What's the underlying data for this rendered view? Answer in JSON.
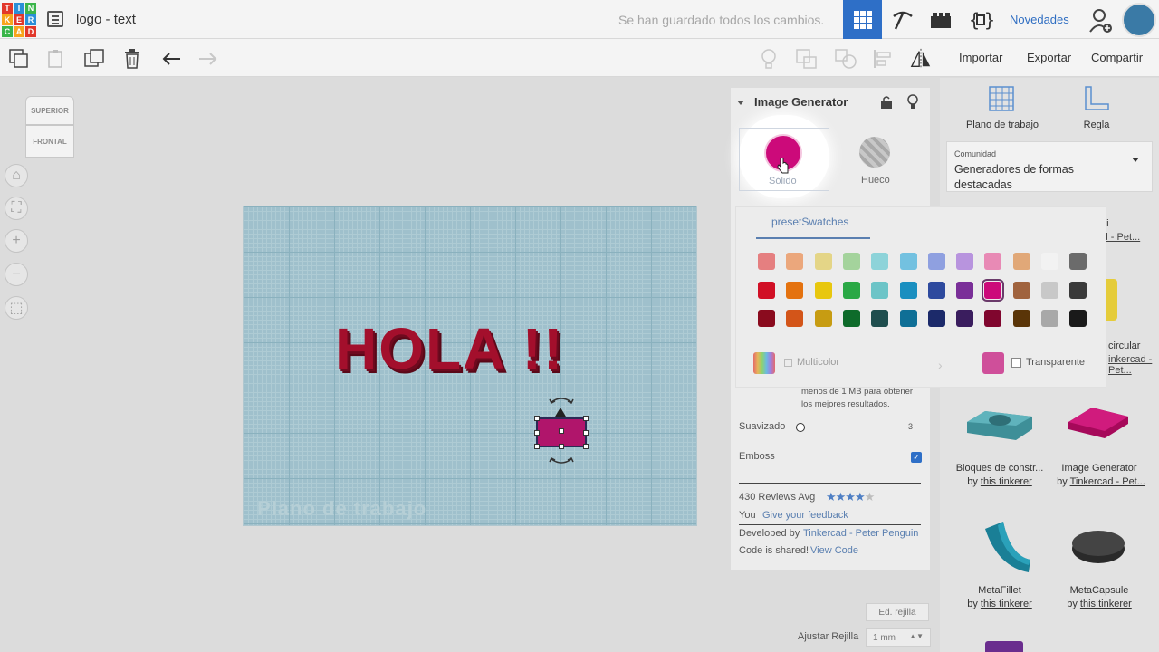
{
  "app": {
    "logo_letters": [
      "TIN",
      "KER",
      "CAD"
    ],
    "doc_title": "logo - text",
    "save_status": "Se han guardado todos los cambios.",
    "news_label": "Novedades"
  },
  "toolbar": {
    "import_label": "Importar",
    "export_label": "Exportar",
    "share_label": "Compartir"
  },
  "viewcube": {
    "top_label": "SUPERIOR",
    "front_label": "FRONTAL"
  },
  "workplane": {
    "label": "Plano de trabajo",
    "text_shape": "HOLA !!"
  },
  "panel": {
    "title": "Image Generator",
    "solid_label": "Sólido",
    "hollow_label": "Hueco",
    "tab_label": "presetSwatches",
    "selected_color": "#cc0a7a",
    "swatch_rows": [
      [
        "#e57f80",
        "#eba77c",
        "#e4d587",
        "#a4d39c",
        "#8dd3d9",
        "#73c1e0",
        "#8fa0e0",
        "#b894de",
        "#e88ab5",
        "#e1a878",
        "#f2f2f2",
        "#6b6b6b"
      ],
      [
        "#d10f25",
        "#e4720f",
        "#e8c70e",
        "#2aa845",
        "#6cc4c7",
        "#1a8fc0",
        "#2e4a9e",
        "#7a2f98",
        "#cc0a7a",
        "#a0633e",
        "#c8c8c8",
        "#3a3a3a"
      ],
      [
        "#8a0b1e",
        "#d35519",
        "#c79c12",
        "#0e6b2a",
        "#1f4e4e",
        "#0f6f96",
        "#1c2a6a",
        "#3a1d5e",
        "#80062e",
        "#5a3508",
        "#a8a8a8",
        "#1a1a1a"
      ]
    ],
    "multicolor_label": "Multicolor",
    "transparent_label": "Transparente",
    "info_text": "menos de 1 MB para obtener los mejores resultados.",
    "smoothing_label": "Suavizado",
    "smoothing_value": "3",
    "emboss_label": "Emboss",
    "emboss_checked": true,
    "reviews_label": "430 Reviews Avg",
    "rating": 4,
    "you_label": "You",
    "feedback_link": "Give your feedback",
    "developed_label": "Developed by",
    "developer_link": "Tinkercad - Peter Penguin",
    "code_label": "Code is shared!",
    "code_link": "View Code"
  },
  "library": {
    "workplane_label": "Plano de trabajo",
    "ruler_label": "Regla",
    "dropdown_small": "Comunidad",
    "dropdown_value": "Generadores de formas destacadas",
    "partial_1": "ei",
    "partial_2": "cad - Pet...",
    "partial_3": "circular",
    "partial_4": "inkercad - Pet...",
    "items": [
      {
        "name": "Bloques de constr...",
        "author_prefix": "by",
        "author": "this tinkerer"
      },
      {
        "name": "Image Generator",
        "author_prefix": "by",
        "author": "Tinkercad - Pet..."
      },
      {
        "name": "MetaFillet",
        "author_prefix": "by",
        "author": "this tinkerer"
      },
      {
        "name": "MetaCapsule",
        "author_prefix": "by",
        "author": "this tinkerer"
      }
    ]
  },
  "bottom": {
    "edit_grid": "Ed. rejilla",
    "snap_label": "Ajustar Rejilla",
    "snap_value": "1 mm"
  }
}
